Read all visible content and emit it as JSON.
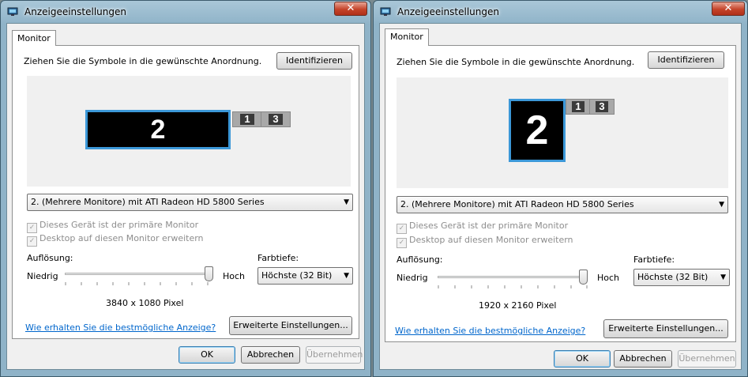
{
  "windows": [
    {
      "title": "Anzeigeeinstellungen",
      "tab": "Monitor",
      "instruction": "Ziehen Sie die Symbole in die gewünschte Anordnung.",
      "identify_label": "Identifizieren",
      "monitors": {
        "active": "2",
        "others": [
          "1",
          "3"
        ]
      },
      "device": "2. (Mehrere Monitore) mit ATI Radeon HD 5800 Series",
      "primary_label": "Dieses Gerät ist der primäre Monitor",
      "extend_label": "Desktop auf diesen Monitor erweitern",
      "resolution_label": "Auflösung:",
      "low_label": "Niedrig",
      "high_label": "Hoch",
      "resolution_value": "3840 x 1080 Pixel",
      "color_depth_label": "Farbtiefe:",
      "color_depth_value": "Höchste (32 Bit)",
      "help_link": "Wie erhalten Sie die bestmögliche Anzeige?",
      "advanced_label": "Erweiterte Einstellungen...",
      "ok_label": "OK",
      "cancel_label": "Abbrechen",
      "apply_label": "Übernehmen",
      "slider_level": 1.0
    },
    {
      "title": "Anzeigeeinstellungen",
      "tab": "Monitor",
      "instruction": "Ziehen Sie die Symbole in die gewünschte Anordnung.",
      "identify_label": "Identifizieren",
      "monitors": {
        "active": "2",
        "others": [
          "1",
          "3"
        ]
      },
      "device": "2. (Mehrere Monitore) mit ATI Radeon HD 5800 Series",
      "primary_label": "Dieses Gerät ist der primäre Monitor",
      "extend_label": "Desktop auf diesen Monitor erweitern",
      "resolution_label": "Auflösung:",
      "low_label": "Niedrig",
      "high_label": "Hoch",
      "resolution_value": "1920 x 2160 Pixel",
      "color_depth_label": "Farbtiefe:",
      "color_depth_value": "Höchste (32 Bit)",
      "help_link": "Wie erhalten Sie die bestmögliche Anzeige?",
      "advanced_label": "Erweiterte Einstellungen...",
      "ok_label": "OK",
      "cancel_label": "Abbrechen",
      "apply_label": "Übernehmen",
      "slider_level": 1.0
    }
  ],
  "icons": {
    "close": "close-icon",
    "app": "display-settings-icon",
    "dropdown": "chevron-down-icon",
    "check": "checkmark-icon"
  },
  "colors": {
    "accent": "#3c98d8",
    "link": "#0066cc",
    "close": "#c5442a"
  }
}
